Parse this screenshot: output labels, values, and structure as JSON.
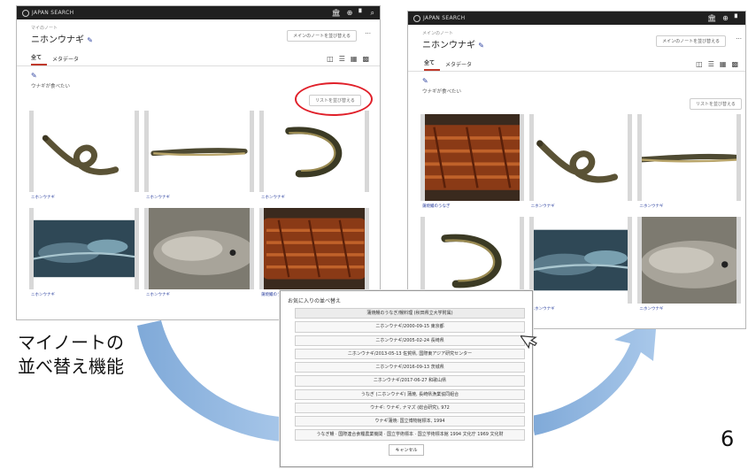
{
  "app": {
    "logo_text": "JAPAN SEARCH"
  },
  "left_screen": {
    "breadcrumb": "マイのノート",
    "title": "ニホンウナギ",
    "sort_button": "メインのノートを並び替える",
    "more": "···",
    "tabs": [
      "全て",
      "メタデータ"
    ],
    "note": "ウナギが食べたい",
    "list_sort_button": "リストを並び替える",
    "items": [
      {
        "caption": "ニホンウナギ",
        "kind": "eel-curled"
      },
      {
        "caption": "ニホンウナギ",
        "kind": "eel-straight"
      },
      {
        "caption": "ニホンウナギ",
        "kind": "eel-u"
      },
      {
        "caption": "ニホンウナギ",
        "kind": "water"
      },
      {
        "caption": "ニホンウナギ",
        "kind": "closeup"
      },
      {
        "caption": "蒲焼鰻のうなぎ",
        "kind": "kabayaki"
      }
    ]
  },
  "right_screen": {
    "breadcrumb": "メインのノート",
    "title": "ニホンウナギ",
    "sort_button": "メインのノートを並び替える",
    "more": "···",
    "tabs": [
      "全て",
      "メタデータ"
    ],
    "note": "ウナギが食べたい",
    "list_sort_button": "リストを並び替える",
    "items": [
      {
        "caption": "蒲焼鰻のうなぎ",
        "kind": "kabayaki"
      },
      {
        "caption": "ニホンウナギ",
        "kind": "eel-curled"
      },
      {
        "caption": "ニホンウナギ",
        "kind": "eel-straight"
      },
      {
        "caption": "",
        "kind": "eel-u"
      },
      {
        "caption": "ニホンウナギ",
        "kind": "water"
      },
      {
        "caption": "ニホンウナギ",
        "kind": "closeup"
      }
    ]
  },
  "sort_dialog": {
    "title": "お気に入りの並べ替え",
    "options": [
      "蒲焼鰻のうなぎ/鰻料理 (秋田県立大学附属)",
      "ニホンウナギ/2000-09-15 東京都",
      "ニホンウナギ/2005-02-24 長崎県",
      "ニホンウナギ/2013-05-13 佐賀県, 国際東アジア研究センター",
      "ニホンウナギ/2016-09-13 茨城県",
      "ニホンウナギ/2017-06-27 和歌山県",
      "うなぎ (ニホンウナギ) 蒲焼, 長崎県漁業協同組合",
      "ウナギ: ウナギ, ナマズ (総合研究), 972",
      "ウナギ蒲焼: 国立博物館標本, 1994",
      "うなぎ鰻 · 国際連合食糧農業機関 · 国立学術標本 · 国立学術標本館 1994 文化庁 1969 文化財"
    ],
    "cancel": "キャンセル"
  },
  "caption_lines": [
    "マイノートの",
    "並べ替え機能"
  ],
  "page_number": "6",
  "colors": {
    "topbar": "#202020",
    "accent_blue": "#2a3f9e",
    "tab_underline": "#c0392b",
    "annotation_red": "#e0202a",
    "arrow_blue": "#8fb5de"
  }
}
